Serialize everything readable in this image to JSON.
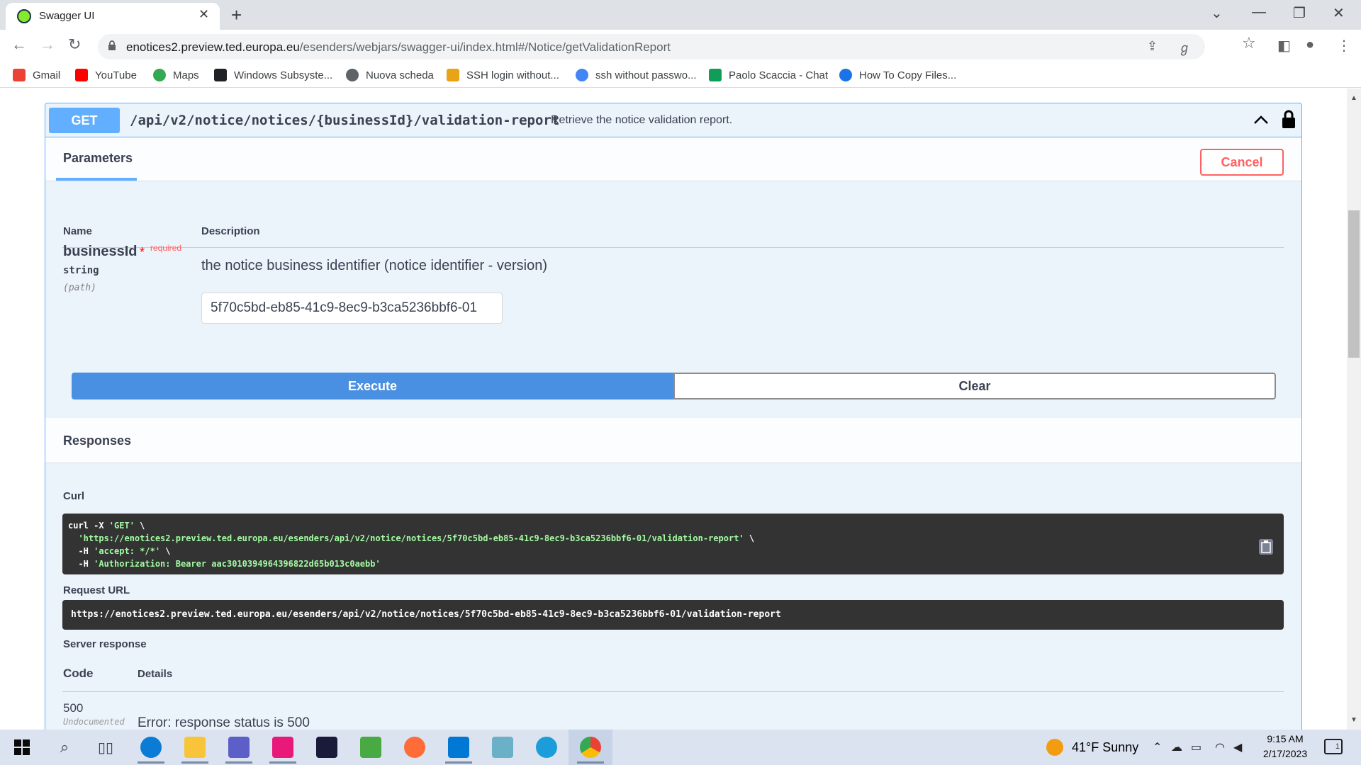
{
  "browser": {
    "tab_title": "Swagger UI",
    "tab_close": "✕",
    "new_tab": "+",
    "url_host": "enotices2.preview.ted.europa.eu",
    "url_path": "/esenders/webjars/swagger-ui/index.html#/Notice/getValidationReport",
    "bookmarks": [
      {
        "label": "Gmail",
        "color": "#ea4335"
      },
      {
        "label": "YouTube",
        "color": "#ff0000"
      },
      {
        "label": "Maps",
        "color": "#34a853"
      },
      {
        "label": "Windows Subsyste...",
        "color": "#202124"
      },
      {
        "label": "Nuova scheda",
        "color": "#5f6368"
      },
      {
        "label": "SSH login without...",
        "color": "#e8a317"
      },
      {
        "label": "ssh without passwo...",
        "color": "#4285f4"
      },
      {
        "label": "Paolo Scaccia - Chat",
        "color": "#0f9d58"
      },
      {
        "label": "How To Copy Files...",
        "color": "#1a73e8"
      }
    ]
  },
  "operation": {
    "method": "GET",
    "path": "/api/v2/notice/notices/{businessId}/validation-report",
    "summary": "Retrieve the notice validation report."
  },
  "parameters": {
    "tab_label": "Parameters",
    "cancel_label": "Cancel",
    "col_name": "Name",
    "col_description": "Description",
    "param": {
      "name": "businessId",
      "required_star": "*",
      "required_label": "required",
      "type": "string",
      "in": "(path)",
      "description": "the notice business identifier (notice identifier - version)",
      "value": "5f70c5bd-eb85-41c9-8ec9-b3ca5236bbf6-01"
    },
    "execute_label": "Execute",
    "clear_label": "Clear"
  },
  "responses": {
    "title": "Responses",
    "curl_label": "Curl",
    "curl_line1_cmd": "curl -X ",
    "curl_line1_str": "'GET'",
    "curl_line1_end": " \\",
    "curl_line2_str": "'https://enotices2.preview.ted.europa.eu/esenders/api/v2/notice/notices/5f70c5bd-eb85-41c9-8ec9-b3ca5236bbf6-01/validation-report'",
    "curl_line2_end": " \\",
    "curl_line3_cmd": "  -H ",
    "curl_line3_str": "'accept: */*'",
    "curl_line3_end": " \\",
    "curl_line4_cmd": "  -H ",
    "curl_line4_str": "'Authorization: Bearer aac3010394964396822d65b013c0aebb'",
    "request_url_label": "Request URL",
    "request_url": "https://enotices2.preview.ted.europa.eu/esenders/api/v2/notice/notices/5f70c5bd-eb85-41c9-8ec9-b3ca5236bbf6-01/validation-report",
    "server_response_label": "Server response",
    "code_header": "Code",
    "details_header": "Details",
    "code": "500",
    "undocumented": "Undocumented",
    "error": "Error: response status is 500"
  },
  "taskbar": {
    "weather": "41°F  Sunny",
    "time": "9:15 AM",
    "date": "2/17/2023",
    "notifications": "1"
  }
}
